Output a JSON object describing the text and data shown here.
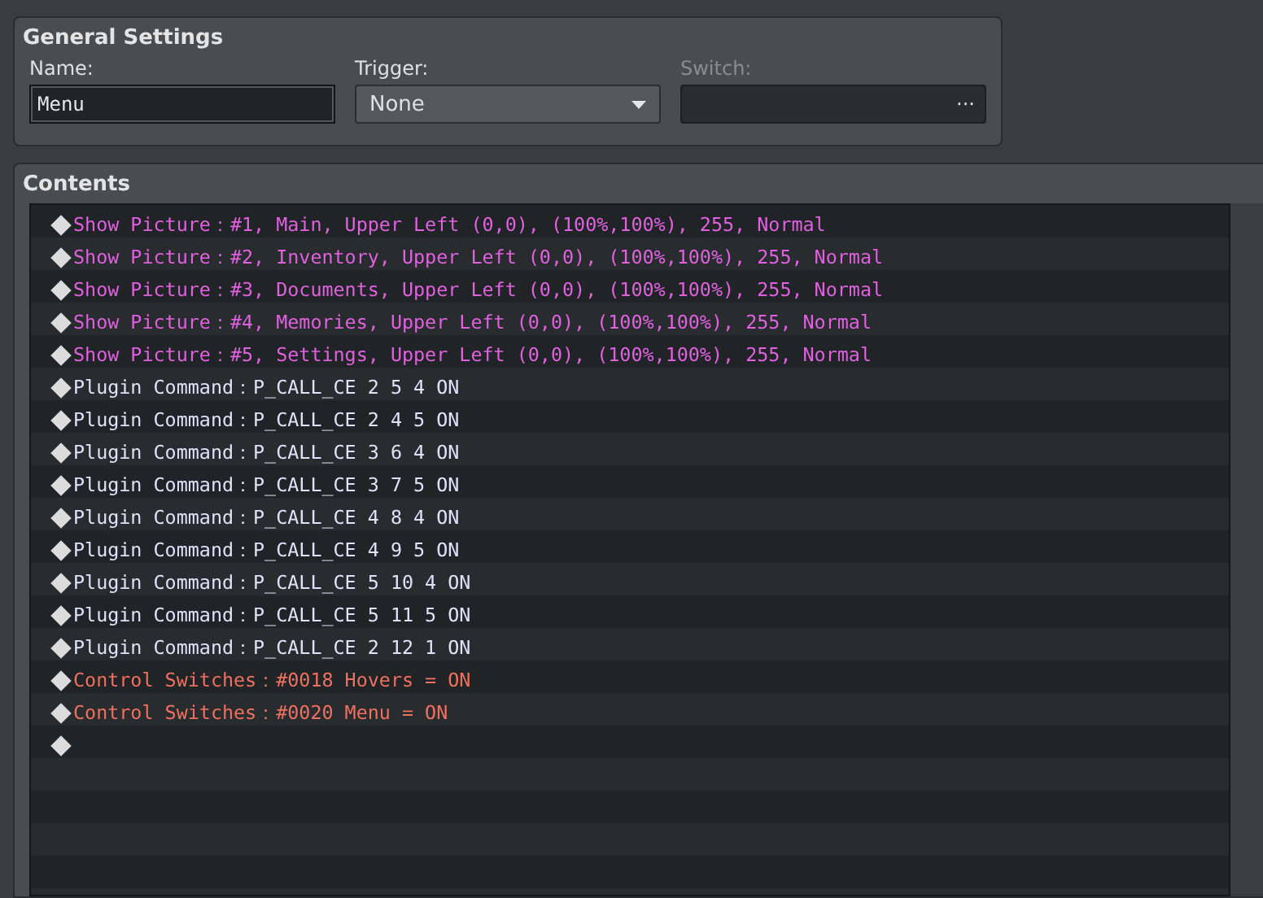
{
  "general_settings": {
    "title": "General Settings",
    "name": {
      "label": "Name:",
      "value": "Menu"
    },
    "trigger": {
      "label": "Trigger:",
      "value": "None"
    },
    "switch": {
      "label": "Switch:",
      "button": "···",
      "disabled": true
    }
  },
  "contents": {
    "title": "Contents",
    "commands": [
      {
        "kind": "picture",
        "text": "Show Picture：#1, Main, Upper Left (0,0), (100%,100%), 255, Normal"
      },
      {
        "kind": "picture",
        "text": "Show Picture：#2, Inventory, Upper Left (0,0), (100%,100%), 255, Normal"
      },
      {
        "kind": "picture",
        "text": "Show Picture：#3, Documents, Upper Left (0,0), (100%,100%), 255, Normal"
      },
      {
        "kind": "picture",
        "text": "Show Picture：#4, Memories, Upper Left (0,0), (100%,100%), 255, Normal"
      },
      {
        "kind": "picture",
        "text": "Show Picture：#5, Settings, Upper Left (0,0), (100%,100%), 255, Normal"
      },
      {
        "kind": "plugin",
        "text": "Plugin Command：P_CALL_CE 2 5 4 ON"
      },
      {
        "kind": "plugin",
        "text": "Plugin Command：P_CALL_CE 2 4 5 ON"
      },
      {
        "kind": "plugin",
        "text": "Plugin Command：P_CALL_CE 3 6 4 ON"
      },
      {
        "kind": "plugin",
        "text": "Plugin Command：P_CALL_CE 3 7 5 ON"
      },
      {
        "kind": "plugin",
        "text": "Plugin Command：P_CALL_CE 4 8 4 ON"
      },
      {
        "kind": "plugin",
        "text": "Plugin Command：P_CALL_CE 4 9 5 ON"
      },
      {
        "kind": "plugin",
        "text": "Plugin Command：P_CALL_CE 5 10 4 ON"
      },
      {
        "kind": "plugin",
        "text": "Plugin Command：P_CALL_CE 5 11 5 ON"
      },
      {
        "kind": "plugin",
        "text": "Plugin Command：P_CALL_CE 2 12 1 ON"
      },
      {
        "kind": "switch",
        "text": "Control Switches：#0018 Hovers = ON"
      },
      {
        "kind": "switch",
        "text": "Control Switches：#0020 Menu = ON"
      },
      {
        "kind": "empty"
      }
    ]
  }
}
